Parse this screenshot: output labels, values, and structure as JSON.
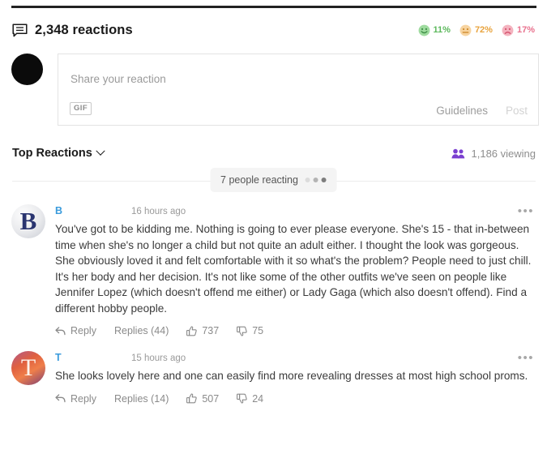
{
  "header": {
    "icon": "comment-bubble-icon",
    "reactions_count": "2,348 reactions",
    "sentiments": [
      {
        "icon": "smiley-happy-icon",
        "percent": "11%",
        "color": "#5cb85c",
        "face": "#9fdb9f"
      },
      {
        "icon": "smiley-neutral-icon",
        "percent": "72%",
        "color": "#e8a33d",
        "face": "#f7d4a0"
      },
      {
        "icon": "smiley-sad-icon",
        "percent": "17%",
        "color": "#e8718d",
        "face": "#f4b3bf"
      }
    ]
  },
  "composer": {
    "avatar": "user-avatar",
    "placeholder": "Share your reaction",
    "gif_label": "GIF",
    "guidelines_label": "Guidelines",
    "post_label": "Post"
  },
  "sortbar": {
    "sort_label": "Top Reactions",
    "viewing_icon": "people-icon",
    "viewing_text": "1,186 viewing"
  },
  "reacting": {
    "text": "7 people reacting"
  },
  "comments": [
    {
      "avatar_letter": "B",
      "author": "B",
      "time": "16 hours ago",
      "menu": "•••",
      "text": "You've got to be kidding me. Nothing is going to ever please everyone. She's 15 - that in-between time when she's no longer a child but not quite an adult either. I thought the look was gorgeous. She obviously loved it and felt comfortable with it so what's the problem? People need to just chill. It's her body and her decision. It's not like some of the other outfits we've seen on people like Jennifer Lopez (which doesn't offend me either) or Lady Gaga (which also doesn't offend). Find a different hobby people.",
      "reply_label": "Reply",
      "replies_label": "Replies (44)",
      "upvotes": "737",
      "downvotes": "75"
    },
    {
      "avatar_letter": "T",
      "author": "T",
      "time": "15 hours ago",
      "menu": "•••",
      "text": "She looks lovely here and one can easily find more revealing dresses at most high school proms.",
      "reply_label": "Reply",
      "replies_label": "Replies (14)",
      "upvotes": "507",
      "downvotes": "24"
    }
  ]
}
